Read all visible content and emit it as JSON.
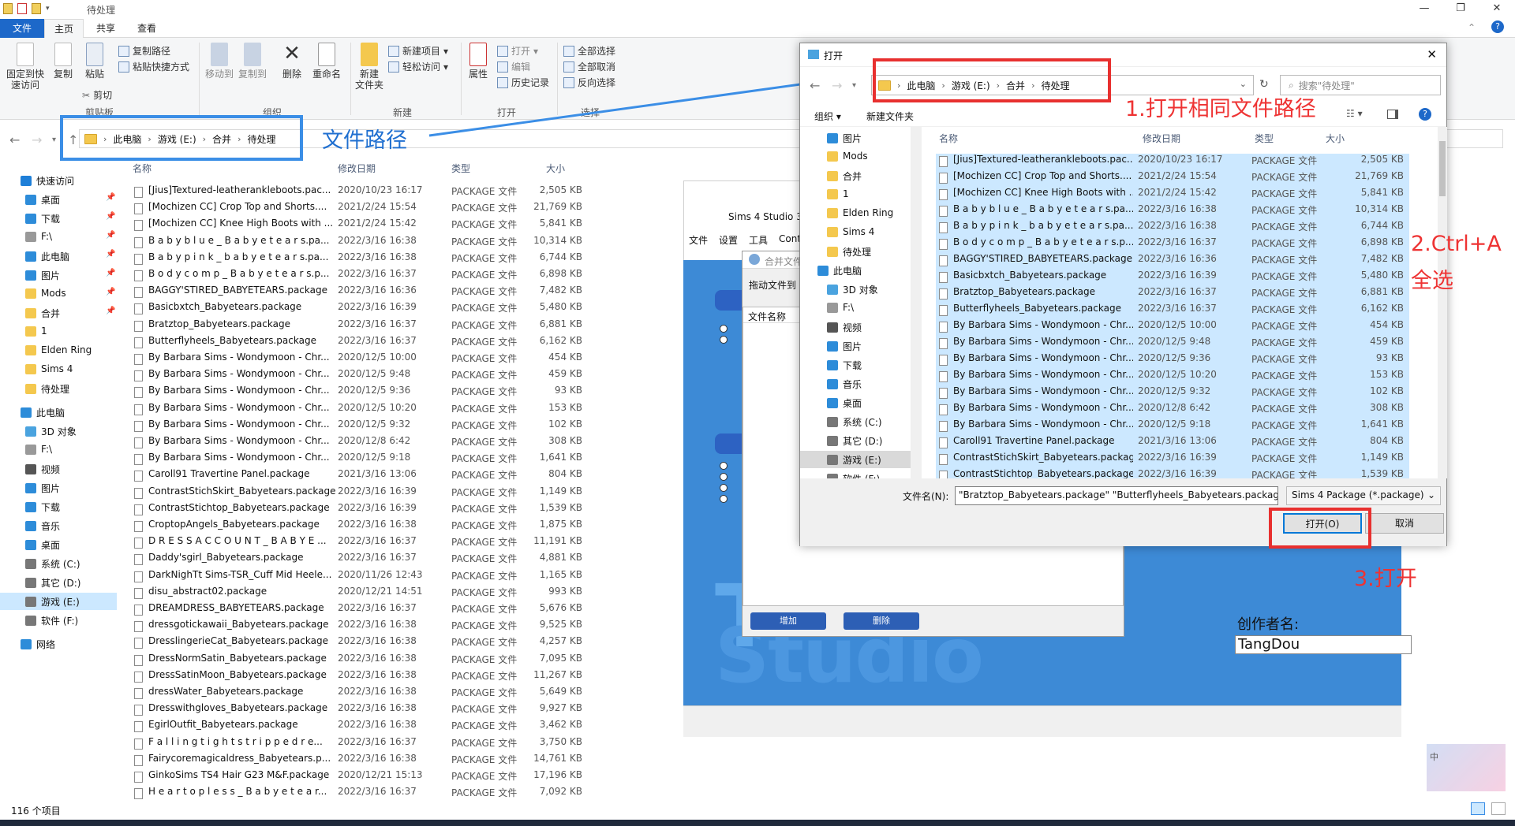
{
  "window": {
    "title": "待处理"
  },
  "ribbon": {
    "tabs": [
      "文件",
      "主页",
      "共享",
      "查看"
    ],
    "pin": "固定到快\n速访问",
    "copy": "复制",
    "paste": "粘贴",
    "copy_path": "复制路径",
    "paste_shortcut": "粘贴快捷方式",
    "cut": "剪切",
    "move_to": "移动到",
    "copy_to": "复制到",
    "delete": "删除",
    "rename": "重命名",
    "new_folder": "新建\n文件夹",
    "new_item": "新建项目",
    "easy_access": "轻松访问",
    "properties": "属性",
    "open": "打开",
    "edit": "编辑",
    "history": "历史记录",
    "select_all": "全部选择",
    "select_none": "全部取消",
    "invert": "反向选择",
    "groups": {
      "clipboard": "剪贴板",
      "organize": "组织",
      "new": "新建",
      "open": "打开",
      "select": "选择"
    }
  },
  "address": {
    "crumbs": [
      "此电脑",
      "游戏 (E:)",
      "合并",
      "待处理"
    ]
  },
  "nav": {
    "items": [
      {
        "label": "快速访问",
        "icon": "star-icon",
        "color": "#1e7fd8",
        "pinned": false,
        "level": 0
      },
      {
        "label": "桌面",
        "icon": "desktop-icon",
        "color": "#2d8cd9",
        "pinned": true,
        "level": 1
      },
      {
        "label": "下载",
        "icon": "download-icon",
        "color": "#2d8cd9",
        "pinned": true,
        "level": 1
      },
      {
        "label": "F:\\",
        "icon": "drive-icon",
        "color": "#999999",
        "pinned": true,
        "level": 1
      },
      {
        "label": "此电脑",
        "icon": "pc-icon",
        "color": "#2d8cd9",
        "pinned": true,
        "level": 1
      },
      {
        "label": "图片",
        "icon": "pictures-icon",
        "color": "#2d8cd9",
        "pinned": true,
        "level": 1
      },
      {
        "label": "Mods",
        "icon": "folder-icon",
        "color": "#f4c84e",
        "pinned": true,
        "level": 1
      },
      {
        "label": "合并",
        "icon": "folder-icon",
        "color": "#f4c84e",
        "pinned": true,
        "level": 1
      },
      {
        "label": "1",
        "icon": "folder-icon",
        "color": "#f4c84e",
        "pinned": false,
        "level": 1
      },
      {
        "label": "Elden Ring",
        "icon": "folder-icon",
        "color": "#f4c84e",
        "pinned": false,
        "level": 1
      },
      {
        "label": "Sims 4",
        "icon": "folder-icon",
        "color": "#f4c84e",
        "pinned": false,
        "level": 1
      },
      {
        "label": "待处理",
        "icon": "folder-icon",
        "color": "#f4c84e",
        "pinned": false,
        "level": 1
      },
      {
        "label": "此电脑",
        "icon": "pc-icon",
        "color": "#2d8cd9",
        "pinned": false,
        "level": 0
      },
      {
        "label": "3D 对象",
        "icon": "3d-icon",
        "color": "#4aa3df",
        "pinned": false,
        "level": 1
      },
      {
        "label": "F:\\",
        "icon": "drive-icon",
        "color": "#999999",
        "pinned": false,
        "level": 1
      },
      {
        "label": "视频",
        "icon": "video-icon",
        "color": "#555555",
        "pinned": false,
        "level": 1
      },
      {
        "label": "图片",
        "icon": "pictures-icon",
        "color": "#2d8cd9",
        "pinned": false,
        "level": 1
      },
      {
        "label": "下载",
        "icon": "download-icon",
        "color": "#2d8cd9",
        "pinned": false,
        "level": 1
      },
      {
        "label": "音乐",
        "icon": "music-icon",
        "color": "#2d8cd9",
        "pinned": false,
        "level": 1
      },
      {
        "label": "桌面",
        "icon": "desktop-icon",
        "color": "#2d8cd9",
        "pinned": false,
        "level": 1
      },
      {
        "label": "系统 (C:)",
        "icon": "drive-icon",
        "color": "#777777",
        "pinned": false,
        "level": 1
      },
      {
        "label": "其它 (D:)",
        "icon": "drive-icon",
        "color": "#777777",
        "pinned": false,
        "level": 1
      },
      {
        "label": "游戏 (E:)",
        "icon": "drive-icon",
        "color": "#777777",
        "pinned": false,
        "level": 1,
        "selected": true
      },
      {
        "label": "软件 (F:)",
        "icon": "drive-icon",
        "color": "#777777",
        "pinned": false,
        "level": 1
      },
      {
        "label": "网络",
        "icon": "network-icon",
        "color": "#2d8cd9",
        "pinned": false,
        "level": 0
      }
    ]
  },
  "columns": {
    "name": "名称",
    "date": "修改日期",
    "type": "类型",
    "size": "大小"
  },
  "files": [
    {
      "name": "[Jius]Textured-leatherankleboots.pac...",
      "date": "2020/10/23 16:17",
      "type": "PACKAGE 文件",
      "size": "2,505 KB"
    },
    {
      "name": "[Mochizen CC] Crop Top and Shorts....",
      "date": "2021/2/24 15:54",
      "type": "PACKAGE 文件",
      "size": "21,769 KB"
    },
    {
      "name": "[Mochizen CC] Knee High Boots with ...",
      "date": "2021/2/24 15:42",
      "type": "PACKAGE 文件",
      "size": "5,841 KB"
    },
    {
      "name": "B a b y b l u e _ B a b y e t e a r s.pa...",
      "date": "2022/3/16 16:38",
      "type": "PACKAGE 文件",
      "size": "10,314 KB"
    },
    {
      "name": "B a b y p i n k _ b a b y e t e a r s.pa...",
      "date": "2022/3/16 16:38",
      "type": "PACKAGE 文件",
      "size": "6,744 KB"
    },
    {
      "name": "B o d y c o m p _ B a b y e t e a r s.p...",
      "date": "2022/3/16 16:37",
      "type": "PACKAGE 文件",
      "size": "6,898 KB"
    },
    {
      "name": "BAGGY'STIRED_BABYETEARS.package",
      "date": "2022/3/16 16:36",
      "type": "PACKAGE 文件",
      "size": "7,482 KB"
    },
    {
      "name": "Basicbxtch_Babyetears.package",
      "date": "2022/3/16 16:39",
      "type": "PACKAGE 文件",
      "size": "5,480 KB"
    },
    {
      "name": "Bratztop_Babyetears.package",
      "date": "2022/3/16 16:37",
      "type": "PACKAGE 文件",
      "size": "6,881 KB"
    },
    {
      "name": "Butterflyheels_Babyetears.package",
      "date": "2022/3/16 16:37",
      "type": "PACKAGE 文件",
      "size": "6,162 KB"
    },
    {
      "name": "By Barbara Sims - Wondymoon - Chr...",
      "date": "2020/12/5 10:00",
      "type": "PACKAGE 文件",
      "size": "454 KB"
    },
    {
      "name": "By Barbara Sims - Wondymoon - Chr...",
      "date": "2020/12/5 9:48",
      "type": "PACKAGE 文件",
      "size": "459 KB"
    },
    {
      "name": "By Barbara Sims - Wondymoon - Chr...",
      "date": "2020/12/5 9:36",
      "type": "PACKAGE 文件",
      "size": "93 KB"
    },
    {
      "name": "By Barbara Sims - Wondymoon - Chr...",
      "date": "2020/12/5 10:20",
      "type": "PACKAGE 文件",
      "size": "153 KB"
    },
    {
      "name": "By Barbara Sims - Wondymoon - Chr...",
      "date": "2020/12/5 9:32",
      "type": "PACKAGE 文件",
      "size": "102 KB"
    },
    {
      "name": "By Barbara Sims - Wondymoon - Chr...",
      "date": "2020/12/8 6:42",
      "type": "PACKAGE 文件",
      "size": "308 KB"
    },
    {
      "name": "By Barbara Sims - Wondymoon - Chr...",
      "date": "2020/12/5 9:18",
      "type": "PACKAGE 文件",
      "size": "1,641 KB"
    },
    {
      "name": "Caroll91 Travertine Panel.package",
      "date": "2021/3/16 13:06",
      "type": "PACKAGE 文件",
      "size": "804 KB"
    },
    {
      "name": "ContrastStichSkirt_Babyetears.package",
      "date": "2022/3/16 16:39",
      "type": "PACKAGE 文件",
      "size": "1,149 KB"
    },
    {
      "name": "ContrastStichtop_Babyetears.package",
      "date": "2022/3/16 16:39",
      "type": "PACKAGE 文件",
      "size": "1,539 KB"
    },
    {
      "name": "CroptopAngels_Babyetears.package",
      "date": "2022/3/16 16:38",
      "type": "PACKAGE 文件",
      "size": "1,875 KB"
    },
    {
      "name": "D R E S S A C C O U N T _ B A B Y E ...",
      "date": "2022/3/16 16:37",
      "type": "PACKAGE 文件",
      "size": "11,191 KB"
    },
    {
      "name": "Daddy'sgirl_Babyetears.package",
      "date": "2022/3/16 16:37",
      "type": "PACKAGE 文件",
      "size": "4,881 KB"
    },
    {
      "name": "DarkNighTt Sims-TSR_Cuff Mid Heele...",
      "date": "2020/11/26 12:43",
      "type": "PACKAGE 文件",
      "size": "1,165 KB"
    },
    {
      "name": "disu_abstract02.package",
      "date": "2020/12/21 14:51",
      "type": "PACKAGE 文件",
      "size": "993 KB"
    },
    {
      "name": "DREAMDRESS_BABYETEARS.package",
      "date": "2022/3/16 16:37",
      "type": "PACKAGE 文件",
      "size": "5,676 KB"
    },
    {
      "name": "dressgotickawaii_Babyetears.package",
      "date": "2022/3/16 16:38",
      "type": "PACKAGE 文件",
      "size": "9,525 KB"
    },
    {
      "name": "DresslingerieCat_Babyetears.package",
      "date": "2022/3/16 16:38",
      "type": "PACKAGE 文件",
      "size": "4,257 KB"
    },
    {
      "name": "DressNormSatin_Babyetears.package",
      "date": "2022/3/16 16:38",
      "type": "PACKAGE 文件",
      "size": "7,095 KB"
    },
    {
      "name": "DressSatinMoon_Babyetears.package",
      "date": "2022/3/16 16:38",
      "type": "PACKAGE 文件",
      "size": "11,267 KB"
    },
    {
      "name": "dressWater_Babyetears.package",
      "date": "2022/3/16 16:38",
      "type": "PACKAGE 文件",
      "size": "5,649 KB"
    },
    {
      "name": "Dresswithgloves_Babyetears.package",
      "date": "2022/3/16 16:38",
      "type": "PACKAGE 文件",
      "size": "9,927 KB"
    },
    {
      "name": "EgirlOutfit_Babyetears.package",
      "date": "2022/3/16 16:38",
      "type": "PACKAGE 文件",
      "size": "3,462 KB"
    },
    {
      "name": "F a l l i n g t i g h t s t r i p p e d r e...",
      "date": "2022/3/16 16:37",
      "type": "PACKAGE 文件",
      "size": "3,750 KB"
    },
    {
      "name": "Fairycoremagicaldress_Babyetears.p...",
      "date": "2022/3/16 16:38",
      "type": "PACKAGE 文件",
      "size": "14,761 KB"
    },
    {
      "name": "GinkoSims TS4 Hair G23 M&F.package",
      "date": "2020/12/21 15:13",
      "type": "PACKAGE 文件",
      "size": "17,196 KB"
    },
    {
      "name": "H e a r t o p l e s s _ B a b y e t e a r...",
      "date": "2022/3/16 16:37",
      "type": "PACKAGE 文件",
      "size": "7,092 KB"
    }
  ],
  "status": {
    "count": "116 个项目"
  },
  "annotations": {
    "path": "文件路径",
    "step1": "1.打开相同文件路径",
    "step2a": "2.Ctrl+A",
    "step2b": "全选",
    "step3": "3.打开"
  },
  "studio": {
    "title": "Sims 4 Studio 3.",
    "menu": [
      "文件",
      "设置",
      "工具",
      "Cont"
    ],
    "merge_title": "合并文件",
    "merge_hint": "拖动文件到",
    "merge_col": "文件名称",
    "add": "增加",
    "remove": "删除",
    "author_label": "创作者名:",
    "author_value": "TangDou",
    "logo_t": "T",
    "logo_text": "Studio"
  },
  "dialog": {
    "title": "打开",
    "crumbs": [
      "此电脑",
      "游戏 (E:)",
      "合并",
      "待处理"
    ],
    "search_placeholder": "搜索\"待处理\"",
    "organize": "组织",
    "new_folder": "新建文件夹",
    "columns": {
      "name": "名称",
      "date": "修改日期",
      "type": "类型",
      "size": "大小"
    },
    "nav": [
      {
        "label": "图片",
        "icon": "pictures-icon",
        "color": "#2d8cd9",
        "level": 1
      },
      {
        "label": "Mods",
        "icon": "folder-icon",
        "color": "#f4c84e",
        "level": 1
      },
      {
        "label": "合并",
        "icon": "folder-icon",
        "color": "#f4c84e",
        "level": 1
      },
      {
        "label": "1",
        "icon": "folder-icon",
        "color": "#f4c84e",
        "level": 1
      },
      {
        "label": "Elden Ring",
        "icon": "folder-icon",
        "color": "#f4c84e",
        "level": 1
      },
      {
        "label": "Sims 4",
        "icon": "folder-icon",
        "color": "#f4c84e",
        "level": 1
      },
      {
        "label": "待处理",
        "icon": "folder-icon",
        "color": "#f4c84e",
        "level": 1
      },
      {
        "label": "此电脑",
        "icon": "pc-icon",
        "color": "#2d8cd9",
        "level": 0
      },
      {
        "label": "3D 对象",
        "icon": "3d-icon",
        "color": "#4aa3df",
        "level": 1
      },
      {
        "label": "F:\\",
        "icon": "drive-icon",
        "color": "#999999",
        "level": 1
      },
      {
        "label": "视频",
        "icon": "video-icon",
        "color": "#555555",
        "level": 1
      },
      {
        "label": "图片",
        "icon": "pictures-icon",
        "color": "#2d8cd9",
        "level": 1
      },
      {
        "label": "下载",
        "icon": "download-icon",
        "color": "#2d8cd9",
        "level": 1
      },
      {
        "label": "音乐",
        "icon": "music-icon",
        "color": "#2d8cd9",
        "level": 1
      },
      {
        "label": "桌面",
        "icon": "desktop-icon",
        "color": "#2d8cd9",
        "level": 1
      },
      {
        "label": "系统 (C:)",
        "icon": "drive-icon",
        "color": "#777777",
        "level": 1
      },
      {
        "label": "其它 (D:)",
        "icon": "drive-icon",
        "color": "#777777",
        "level": 1
      },
      {
        "label": "游戏 (E:)",
        "icon": "drive-icon",
        "color": "#777777",
        "level": 1,
        "selected": true
      },
      {
        "label": "软件 (F:)",
        "icon": "drive-icon",
        "color": "#777777",
        "level": 1
      }
    ],
    "filename_label": "文件名(N):",
    "filename_value": "\"Bratztop_Babyetears.package\" \"Butterflyheels_Babyetears.packag",
    "filetype": "Sims 4 Package (*.package)",
    "open": "打开(O)",
    "cancel": "取消"
  },
  "ime": {
    "mode": "中"
  }
}
